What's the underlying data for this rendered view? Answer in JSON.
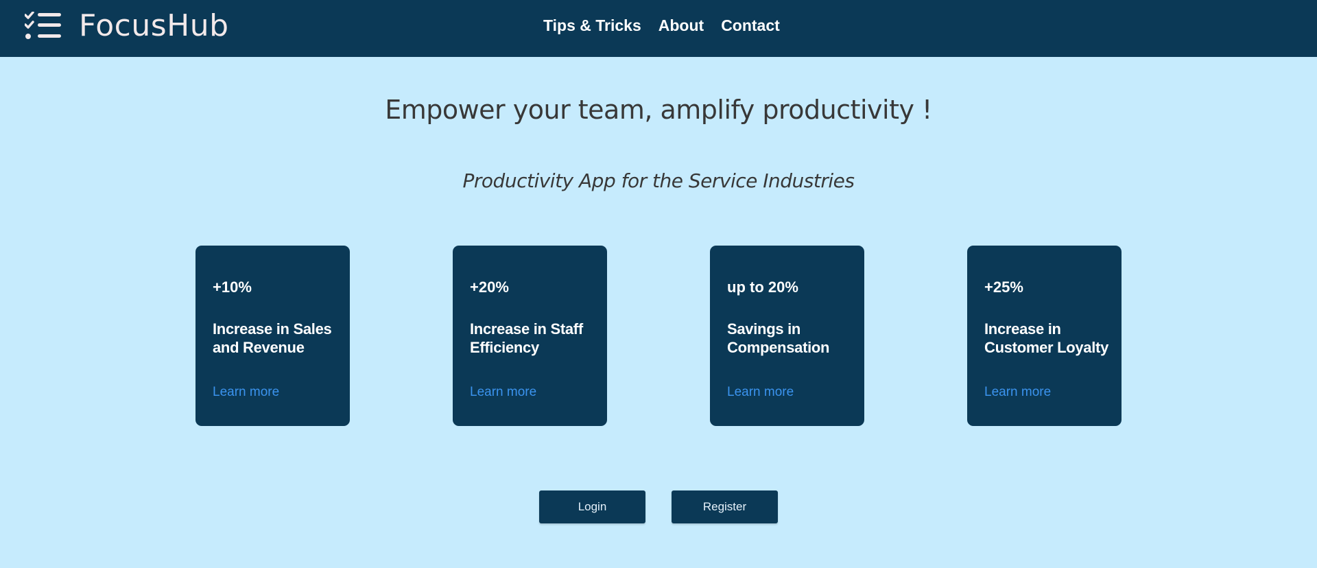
{
  "header": {
    "logo_icon": "checklist-icon",
    "brand": "FocusHub",
    "nav": [
      {
        "label": "Tips & Tricks"
      },
      {
        "label": "About"
      },
      {
        "label": "Contact"
      }
    ]
  },
  "hero": {
    "headline": "Empower your team, amplify productivity !",
    "subheadline": "Productivity App for the Service Industries"
  },
  "cards": [
    {
      "stat": "+10%",
      "description": "Increase in Sales and Revenue",
      "link": "Learn more"
    },
    {
      "stat": "+20%",
      "description": "Increase in Staff Efficiency",
      "link": "Learn more"
    },
    {
      "stat": "up to 20%",
      "description": "Savings in Compensation",
      "link": "Learn more"
    },
    {
      "stat": "+25%",
      "description": "Increase in Customer Loyalty",
      "link": "Learn more"
    }
  ],
  "actions": {
    "login": "Login",
    "register": "Register"
  },
  "colors": {
    "page_background": "#c6ebfd",
    "primary": "#0b3956",
    "link": "#3b93ee",
    "text_dark": "#383838",
    "brand_text": "#f2e9ea"
  }
}
